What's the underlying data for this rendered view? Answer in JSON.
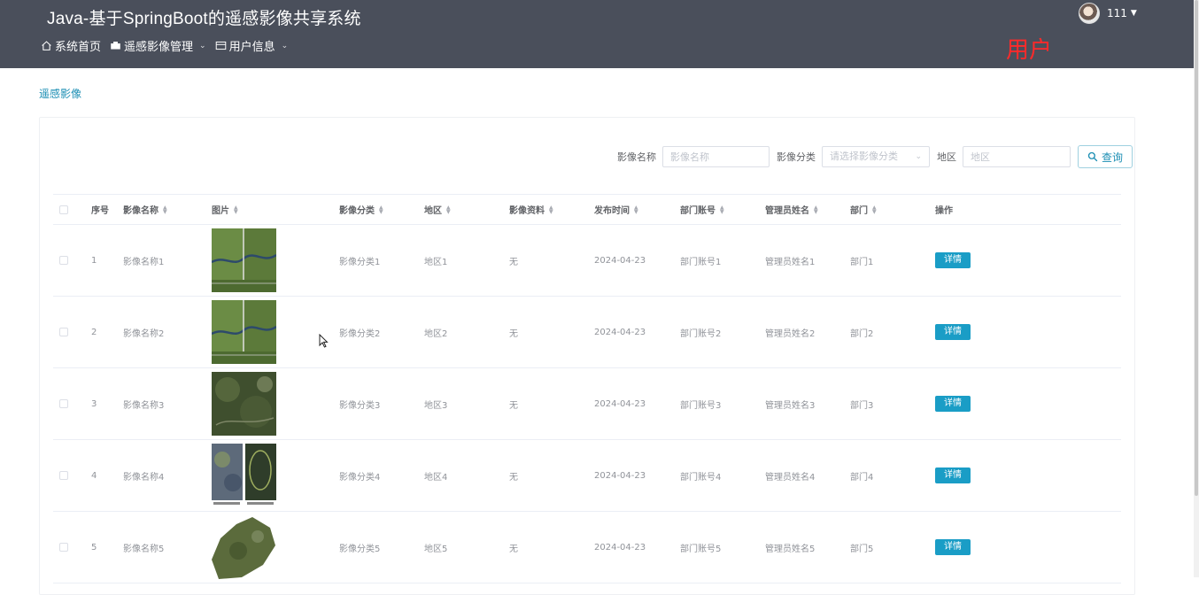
{
  "header": {
    "title": "Java-基于SpringBoot的遥感影像共享系统",
    "nav": [
      {
        "label": "系统首页",
        "icon": "home-icon"
      },
      {
        "label": "遥感影像管理",
        "icon": "image-icon"
      },
      {
        "label": "用户信息",
        "icon": "card-icon"
      }
    ],
    "user_name": "111",
    "role_label": "用户",
    "colors": {
      "bar": "#4a4f5b",
      "role": "#ff2a2a"
    }
  },
  "breadcrumb": "遥感影像",
  "search": {
    "name_label": "影像名称",
    "name_placeholder": "影像名称",
    "category_label": "影像分类",
    "category_placeholder": "请选择影像分类",
    "region_label": "地区",
    "region_placeholder": "地区",
    "button_label": "查询",
    "accent": "#1d8fb4"
  },
  "table": {
    "headers": [
      "序号",
      "影像名称",
      "图片",
      "影像分类",
      "地区",
      "影像资料",
      "发布时间",
      "部门账号",
      "管理员姓名",
      "部门",
      "操作"
    ],
    "rows": [
      {
        "no": "1",
        "name": "影像名称1",
        "category": "影像分类1",
        "region": "地区1",
        "data": "无",
        "date": "2024-04-23",
        "account": "部门账号1",
        "admin": "管理员姓名1",
        "dept": "部门1",
        "action": "详情"
      },
      {
        "no": "2",
        "name": "影像名称2",
        "category": "影像分类2",
        "region": "地区2",
        "data": "无",
        "date": "2024-04-23",
        "account": "部门账号2",
        "admin": "管理员姓名2",
        "dept": "部门2",
        "action": "详情"
      },
      {
        "no": "3",
        "name": "影像名称3",
        "category": "影像分类3",
        "region": "地区3",
        "data": "无",
        "date": "2024-04-23",
        "account": "部门账号3",
        "admin": "管理员姓名3",
        "dept": "部门3",
        "action": "详情"
      },
      {
        "no": "4",
        "name": "影像名称4",
        "category": "影像分类4",
        "region": "地区4",
        "data": "无",
        "date": "2024-04-23",
        "account": "部门账号4",
        "admin": "管理员姓名4",
        "dept": "部门4",
        "action": "详情"
      },
      {
        "no": "5",
        "name": "影像名称5",
        "category": "影像分类5",
        "region": "地区5",
        "data": "无",
        "date": "2024-04-23",
        "account": "部门账号5",
        "admin": "管理员姓名5",
        "dept": "部门5",
        "action": "详情"
      }
    ],
    "detail_color": "#1a9dc6"
  }
}
